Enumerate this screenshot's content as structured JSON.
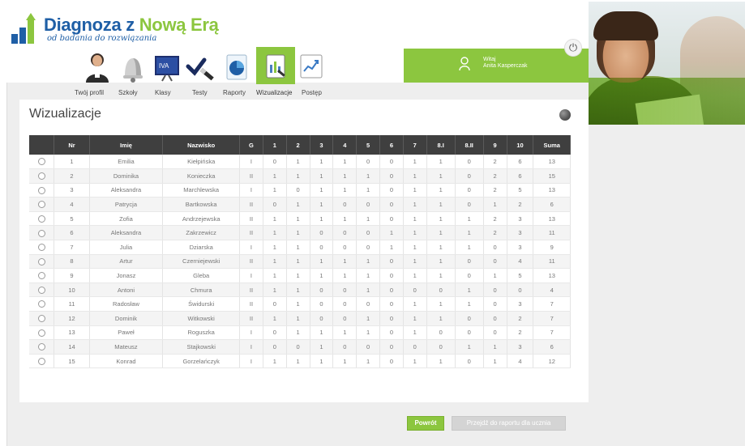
{
  "app": {
    "logo_title_part1": "Diagnoza z ",
    "logo_title_part2": "Nową Erą",
    "logo_subtitle": "od badania do rozwiązania"
  },
  "nav": {
    "items": [
      {
        "label": "Twój profil",
        "icon": "profile-icon"
      },
      {
        "label": "Szkoły",
        "icon": "school-bell-icon"
      },
      {
        "label": "Klasy",
        "icon": "classroom-board-icon"
      },
      {
        "label": "Testy",
        "icon": "checkmark-pen-icon"
      },
      {
        "label": "Raporty",
        "icon": "report-pie-icon"
      },
      {
        "label": "Wizualizacje",
        "icon": "visualization-icon",
        "active": true
      },
      {
        "label": "Postęp",
        "icon": "progress-chart-icon"
      }
    ]
  },
  "user": {
    "greeting": "Witaj",
    "name": "Anita Kasperczak"
  },
  "page": {
    "title": "Wizualizacje"
  },
  "table": {
    "headers": [
      "",
      "Nr",
      "Imię",
      "Nazwisko",
      "G",
      "1",
      "2",
      "3",
      "4",
      "5",
      "6",
      "7",
      "8.I",
      "8.II",
      "9",
      "10",
      "Suma"
    ],
    "rows": [
      [
        "1",
        "Emilia",
        "Kiełpińska",
        "I",
        "0",
        "1",
        "1",
        "1",
        "0",
        "0",
        "1",
        "1",
        "0",
        "2",
        "6",
        "13"
      ],
      [
        "2",
        "Dominika",
        "Konieczka",
        "II",
        "1",
        "1",
        "1",
        "1",
        "1",
        "0",
        "1",
        "1",
        "0",
        "2",
        "6",
        "15"
      ],
      [
        "3",
        "Aleksandra",
        "Marchlewska",
        "I",
        "1",
        "0",
        "1",
        "1",
        "1",
        "0",
        "1",
        "1",
        "0",
        "2",
        "5",
        "13"
      ],
      [
        "4",
        "Patrycja",
        "Bartkowska",
        "II",
        "0",
        "1",
        "1",
        "0",
        "0",
        "0",
        "1",
        "1",
        "0",
        "1",
        "2",
        "6"
      ],
      [
        "5",
        "Zofia",
        "Andrzejewska",
        "II",
        "1",
        "1",
        "1",
        "1",
        "1",
        "0",
        "1",
        "1",
        "1",
        "2",
        "3",
        "13"
      ],
      [
        "6",
        "Aleksandra",
        "Zakrzewicz",
        "II",
        "1",
        "1",
        "0",
        "0",
        "0",
        "1",
        "1",
        "1",
        "1",
        "2",
        "3",
        "11"
      ],
      [
        "7",
        "Julia",
        "Dziarska",
        "I",
        "1",
        "1",
        "0",
        "0",
        "0",
        "1",
        "1",
        "1",
        "1",
        "0",
        "3",
        "9"
      ],
      [
        "8",
        "Artur",
        "Czerniejewski",
        "II",
        "1",
        "1",
        "1",
        "1",
        "1",
        "0",
        "1",
        "1",
        "0",
        "0",
        "4",
        "11"
      ],
      [
        "9",
        "Jonasz",
        "Gleba",
        "I",
        "1",
        "1",
        "1",
        "1",
        "1",
        "0",
        "1",
        "1",
        "0",
        "1",
        "5",
        "13"
      ],
      [
        "10",
        "Antoni",
        "Chmura",
        "II",
        "1",
        "1",
        "0",
        "0",
        "1",
        "0",
        "0",
        "0",
        "1",
        "0",
        "0",
        "4"
      ],
      [
        "11",
        "Radosław",
        "Świdurski",
        "II",
        "0",
        "1",
        "0",
        "0",
        "0",
        "0",
        "1",
        "1",
        "1",
        "0",
        "3",
        "7"
      ],
      [
        "12",
        "Dominik",
        "Witkowski",
        "II",
        "1",
        "1",
        "0",
        "0",
        "1",
        "0",
        "1",
        "1",
        "0",
        "0",
        "2",
        "7"
      ],
      [
        "13",
        "Paweł",
        "Roguszka",
        "I",
        "0",
        "1",
        "1",
        "1",
        "1",
        "0",
        "1",
        "0",
        "0",
        "0",
        "2",
        "7"
      ],
      [
        "14",
        "Mateusz",
        "Stajkowski",
        "I",
        "0",
        "0",
        "1",
        "0",
        "0",
        "0",
        "0",
        "0",
        "1",
        "1",
        "3",
        "6"
      ],
      [
        "15",
        "Konrad",
        "Gorzelańczyk",
        "I",
        "1",
        "1",
        "1",
        "1",
        "1",
        "0",
        "1",
        "1",
        "0",
        "1",
        "4",
        "12"
      ]
    ]
  },
  "buttons": {
    "back": "Powrót",
    "next": "Przejdź do raportu dla ucznia"
  },
  "colors": {
    "accent_green": "#8cc63f",
    "brand_blue": "#1f5fa6",
    "header_dark": "#3f3f3f"
  }
}
